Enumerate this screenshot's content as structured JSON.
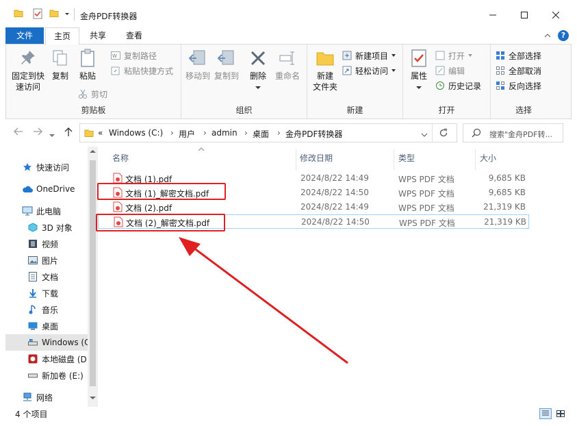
{
  "window": {
    "title": "金舟PDF转换器"
  },
  "ribbon_tabs": [
    "文件",
    "主页",
    "共享",
    "查看"
  ],
  "ribbon": {
    "clipboard": {
      "pin_label": "固定到快\n速访问",
      "pin_label_1": "固定到快",
      "pin_label_2": "速访问",
      "copy_label": "复制",
      "paste_label": "粘贴",
      "copy_path": "复制路径",
      "paste_shortcut": "粘贴快捷方式",
      "cut": "剪切",
      "group": "剪贴板"
    },
    "organize": {
      "move_to": "移动到",
      "copy_to": "复制到",
      "delete": "删除",
      "rename": "重命名",
      "group": "组织"
    },
    "new": {
      "new_folder_1": "新建",
      "new_folder_2": "文件夹",
      "new_item": "新建项目",
      "easy_access": "轻松访问",
      "group": "新建"
    },
    "open": {
      "properties": "属性",
      "open": "打开",
      "edit": "编辑",
      "history": "历史记录",
      "group": "打开"
    },
    "select": {
      "select_all": "全部选择",
      "select_none": "全部取消",
      "invert": "反向选择",
      "group": "选择"
    }
  },
  "address": {
    "prefix": "«",
    "crumbs": [
      "Windows (C:)",
      "用户",
      "admin",
      "桌面",
      "金舟PDF转换器"
    ],
    "search_placeholder": "搜索\"金舟PDF转..."
  },
  "sidebar": {
    "items": [
      {
        "label": "快速访问",
        "icon": "star-icon"
      },
      {
        "label": "OneDrive",
        "icon": "cloud-icon"
      },
      {
        "label": "此电脑",
        "icon": "computer-icon"
      },
      {
        "label": "3D 对象",
        "icon": "cube-icon"
      },
      {
        "label": "视频",
        "icon": "film-icon"
      },
      {
        "label": "图片",
        "icon": "picture-icon"
      },
      {
        "label": "文档",
        "icon": "document-icon"
      },
      {
        "label": "下载",
        "icon": "download-icon"
      },
      {
        "label": "音乐",
        "icon": "music-icon"
      },
      {
        "label": "桌面",
        "icon": "desktop-icon"
      },
      {
        "label": "Windows (C",
        "icon": "drive-icon"
      },
      {
        "label": "本地磁盘 (D",
        "icon": "drive-icon"
      },
      {
        "label": "新加卷 (E:)",
        "icon": "drive-icon"
      },
      {
        "label": "网络",
        "icon": "network-icon"
      }
    ]
  },
  "filelist": {
    "headers": {
      "name": "名称",
      "date": "修改日期",
      "type": "类型",
      "size": "大小"
    },
    "rows": [
      {
        "name": "文档 (1).pdf",
        "date": "2024/8/22 14:49",
        "type": "WPS PDF 文档",
        "size": "9,685 KB"
      },
      {
        "name": "文档 (1)_解密文档.pdf",
        "date": "2024/8/22 14:50",
        "type": "WPS PDF 文档",
        "size": "9,685 KB"
      },
      {
        "name": "文档 (2).pdf",
        "date": "2024/8/22 14:49",
        "type": "WPS PDF 文档",
        "size": "21,319 KB"
      },
      {
        "name": "文档 (2)_解密文档.pdf",
        "date": "2024/8/22 14:50",
        "type": "WPS PDF 文档",
        "size": "21,319 KB"
      }
    ]
  },
  "status": {
    "count": "4 个项目"
  },
  "colors": {
    "accent": "#1a6ec6",
    "annotation": "#e02020"
  }
}
